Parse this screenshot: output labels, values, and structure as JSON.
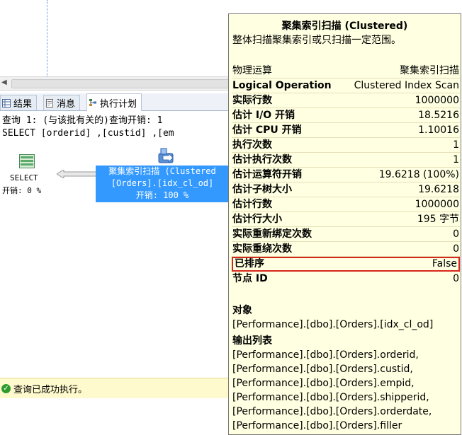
{
  "tabs": [
    {
      "label": "结果",
      "icon": "grid-icon"
    },
    {
      "label": "消息",
      "icon": "message-icon"
    },
    {
      "label": "执行计划",
      "icon": "execution-plan-icon"
    }
  ],
  "query": {
    "line1": "查询 1: (与该批有关的)查询开销: 1",
    "line2": "SELECT [orderid] ,[custid] ,[em"
  },
  "plan": {
    "select_label": "SELECT",
    "select_cost": "开销: 0 %",
    "scan_line1": "聚集索引扫描 (Clustered",
    "scan_line2": "[Orders].[idx_cl_od]",
    "scan_line3": "开销: 100 %"
  },
  "status": {
    "text": "查询已成功执行。"
  },
  "tooltip": {
    "title": "聚集索引扫描 (Clustered)",
    "description": "整体扫描聚集索引或只扫描一定范围。",
    "rows": [
      {
        "key": "物理运算",
        "value": "聚集索引扫描"
      },
      {
        "key": "Logical Operation",
        "value": "Clustered Index Scan"
      },
      {
        "key": "实际行数",
        "value": "1000000"
      },
      {
        "key": "估计 I/O 开销",
        "value": "18.5216"
      },
      {
        "key": "估计 CPU 开销",
        "value": "1.10016"
      },
      {
        "key": "执行次数",
        "value": "1"
      },
      {
        "key": "估计执行次数",
        "value": "1"
      },
      {
        "key": "估计运算符开销",
        "value": "19.6218 (100%)"
      },
      {
        "key": "估计子树大小",
        "value": "19.6218"
      },
      {
        "key": "估计行数",
        "value": "1000000"
      },
      {
        "key": "估计行大小",
        "value": "195 字节"
      },
      {
        "key": "实际重新绑定次数",
        "value": "0"
      },
      {
        "key": "实际重绕次数",
        "value": "0"
      },
      {
        "key": "已排序",
        "value": "False"
      },
      {
        "key": "节点 ID",
        "value": "0"
      }
    ],
    "object_heading": "对象",
    "object_value": "[Performance].[dbo].[Orders].[idx_cl_od]",
    "output_heading": "输出列表",
    "output_list": [
      "[Performance].[dbo].[Orders].orderid,",
      "[Performance].[dbo].[Orders].custid,",
      "[Performance].[dbo].[Orders].empid,",
      "[Performance].[dbo].[Orders].shipperid,",
      "[Performance].[dbo].[Orders].orderdate,",
      "[Performance].[dbo].[Orders].filler"
    ],
    "highlight_color": "#d9261c"
  }
}
